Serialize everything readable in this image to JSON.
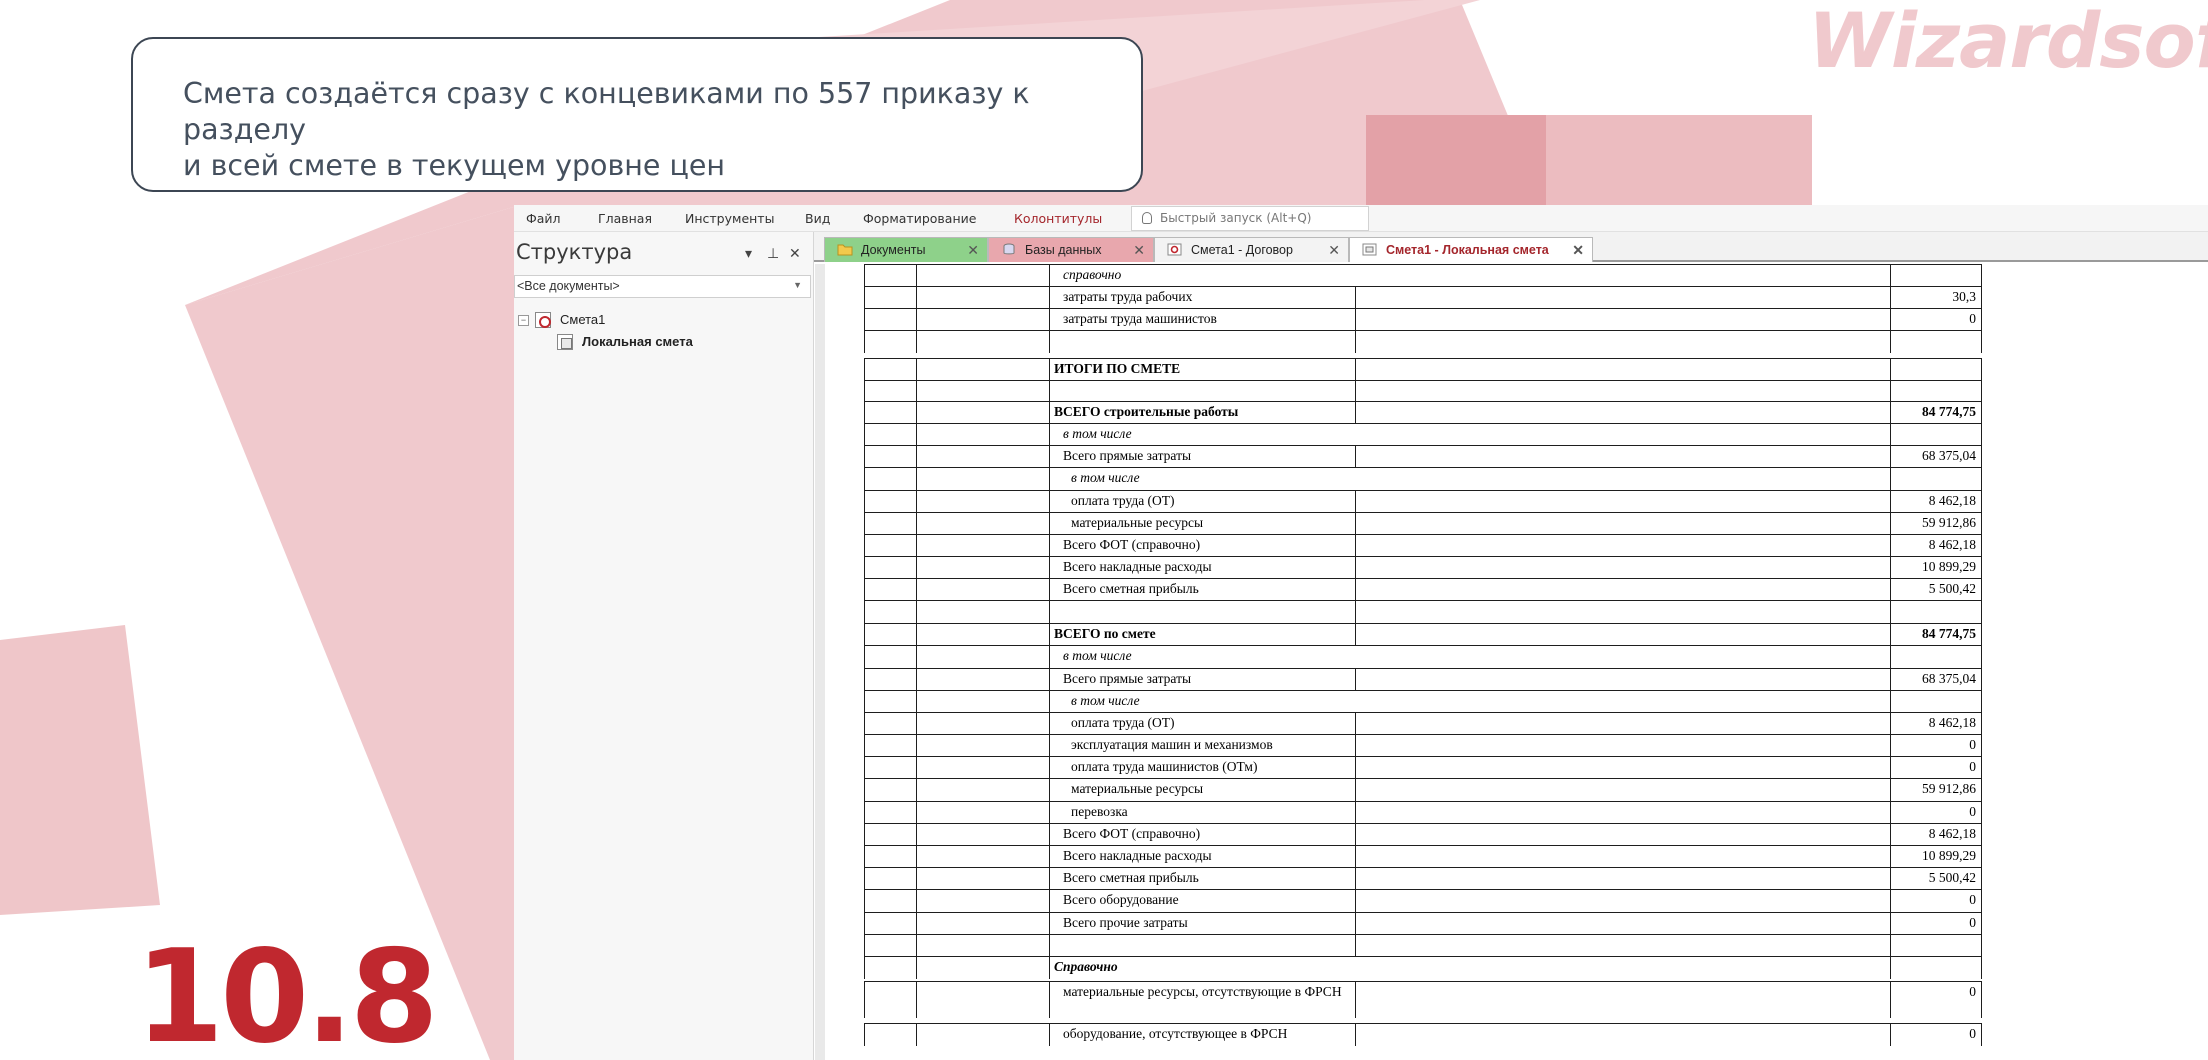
{
  "brand": {
    "logo_text": "Wizardsoft",
    "accent_color": "#c0282f",
    "pink_color": "#e6a2a8"
  },
  "callout": {
    "line1": "Смета создаётся сразу с концевиками по 557 приказу к разделу",
    "line2": "и всей смете в текущем уровне цен"
  },
  "slide_number": "10.8",
  "menu": {
    "items": [
      "Файл",
      "Главная",
      "Инструменты",
      "Вид",
      "Форматирование",
      "Колонтитулы"
    ],
    "quick_launch_placeholder": "Быстрый запуск (Alt+Q)"
  },
  "structure_panel": {
    "title": "Структура",
    "pin_icon": "pin-icon",
    "filter_value": "<Все документы>",
    "tree": [
      {
        "label": "Смета1",
        "icon": "estimate-icon"
      },
      {
        "label": "Локальная смета",
        "icon": "local-estimate-icon"
      }
    ]
  },
  "tabs": [
    {
      "label": "Документы",
      "icon": "folder-icon"
    },
    {
      "label": "Базы данных",
      "icon": "database-icon"
    },
    {
      "label": "Смета1 - Договор",
      "icon": "estimate-icon"
    },
    {
      "label": "Смета1 - Локальная смета",
      "icon": "local-estimate-icon",
      "active": true
    }
  ],
  "estimate_rows": [
    {
      "label": "справочно",
      "value": "",
      "style": "italic",
      "indent": 1
    },
    {
      "label": "затраты труда рабочих",
      "value": "30,3",
      "style": "normal",
      "indent": 1
    },
    {
      "label": "затраты труда машинистов",
      "value": "0",
      "style": "normal",
      "indent": 1
    },
    {
      "label": "ИТОГИ ПО СМЕТЕ",
      "value": "",
      "style": "bold",
      "indent": 0
    },
    {
      "label": "ВСЕГО строительные работы",
      "value": "84 774,75",
      "style": "bold",
      "indent": 0
    },
    {
      "label": "в том числе",
      "value": "",
      "style": "italic",
      "indent": 1
    },
    {
      "label": "Всего прямые затраты",
      "value": "68 375,04",
      "style": "normal",
      "indent": 1
    },
    {
      "label": "в том числе",
      "value": "",
      "style": "italic",
      "indent": 2
    },
    {
      "label": "оплата труда (ОТ)",
      "value": "8 462,18",
      "style": "normal",
      "indent": 2
    },
    {
      "label": "материальные ресурсы",
      "value": "59 912,86",
      "style": "normal",
      "indent": 2
    },
    {
      "label": "Всего ФОТ (справочно)",
      "value": "8 462,18",
      "style": "normal",
      "indent": 1
    },
    {
      "label": "Всего накладные расходы",
      "value": "10 899,29",
      "style": "normal",
      "indent": 1
    },
    {
      "label": "Всего сметная прибыль",
      "value": "5 500,42",
      "style": "normal",
      "indent": 1
    },
    {
      "label": "ВСЕГО по смете",
      "value": "84 774,75",
      "style": "bold",
      "indent": 0
    },
    {
      "label": "в том числе",
      "value": "",
      "style": "italic",
      "indent": 1
    },
    {
      "label": "Всего прямые затраты",
      "value": "68 375,04",
      "style": "normal",
      "indent": 1
    },
    {
      "label": "в том числе",
      "value": "",
      "style": "italic",
      "indent": 2
    },
    {
      "label": "оплата труда (ОТ)",
      "value": "8 462,18",
      "style": "normal",
      "indent": 2
    },
    {
      "label": "эксплуатация машин и механизмов",
      "value": "0",
      "style": "normal",
      "indent": 2
    },
    {
      "label": "оплата труда машинистов (ОТм)",
      "value": "0",
      "style": "normal",
      "indent": 2
    },
    {
      "label": "материальные ресурсы",
      "value": "59 912,86",
      "style": "normal",
      "indent": 2
    },
    {
      "label": "перевозка",
      "value": "0",
      "style": "normal",
      "indent": 2
    },
    {
      "label": "Всего ФОТ (справочно)",
      "value": "8 462,18",
      "style": "normal",
      "indent": 1
    },
    {
      "label": "Всего накладные расходы",
      "value": "10 899,29",
      "style": "normal",
      "indent": 1
    },
    {
      "label": "Всего сметная прибыль",
      "value": "5 500,42",
      "style": "normal",
      "indent": 1
    },
    {
      "label": "Всего оборудование",
      "value": "0",
      "style": "normal",
      "indent": 1
    },
    {
      "label": "Всего прочие затраты",
      "value": "0",
      "style": "normal",
      "indent": 1
    },
    {
      "label": "Справочно",
      "value": "",
      "style": "bold-italic",
      "indent": 0
    },
    {
      "label": "материальные ресурсы, отсутствующие в ФРСН",
      "value": "0",
      "style": "normal",
      "indent": 1
    },
    {
      "label": "оборудование, отсутствующее в ФРСН",
      "value": "0",
      "style": "normal",
      "indent": 1
    }
  ]
}
